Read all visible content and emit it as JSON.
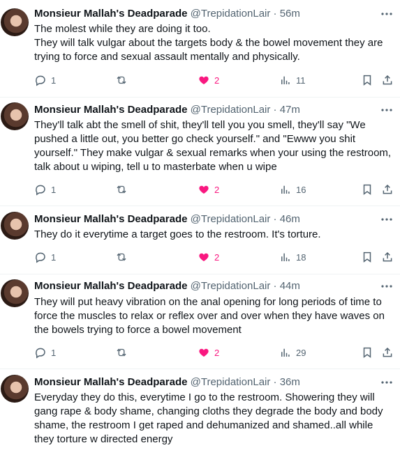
{
  "tweets": [
    {
      "name": "Monsieur Mallah's Deadparade",
      "handle": "@TrepidationLair",
      "sep": "·",
      "time": "56m",
      "lines": [
        "The molest while they are doing it too.",
        "They will talk vulgar about the targets body & the  bowel movement they are",
        "trying to force and sexual assault mentally and physically."
      ],
      "replies": "1",
      "likes": "2",
      "views": "11"
    },
    {
      "name": "Monsieur Mallah's Deadparade",
      "handle": "@TrepidationLair",
      "sep": "·",
      "time": "47m",
      "lines": [
        "They'll talk abt the smell of shit, they'll tell you you smell, they'll say \"We",
        "pushed a little out, you better go check yourself.\" and \"Ewww you shit",
        "yourself.\" They make vulgar & sexual remarks when your using the restroom,",
        "talk about u wiping, tell u to masterbate when u wipe"
      ],
      "replies": "1",
      "likes": "2",
      "views": "16"
    },
    {
      "name": "Monsieur Mallah's Deadparade",
      "handle": "@TrepidationLair",
      "sep": "·",
      "time": "46m",
      "lines": [
        "They do it everytime a target goes to the restroom. It's torture."
      ],
      "replies": "1",
      "likes": "2",
      "views": "18"
    },
    {
      "name": "Monsieur Mallah's Deadparade",
      "handle": "@TrepidationLair",
      "sep": "·",
      "time": "44m",
      "lines": [
        "They will put heavy vibration on the anal opening for long periods of time to",
        "force the muscles to relax or reflex over and over when they have waves on",
        "the bowels trying to force a bowel movement"
      ],
      "replies": "1",
      "likes": "2",
      "views": "29"
    },
    {
      "name": "Monsieur Mallah's Deadparade",
      "handle": "@TrepidationLair",
      "sep": "·",
      "time": "36m",
      "lines": [
        "Everyday they do this, everytime I go to the restroom. Showering they will",
        "gang rape & body shame, changing cloths they degrade the body and body",
        "shame, the restroom I get raped and dehumanized and shamed..all while",
        "they torture w directed energy"
      ]
    }
  ]
}
